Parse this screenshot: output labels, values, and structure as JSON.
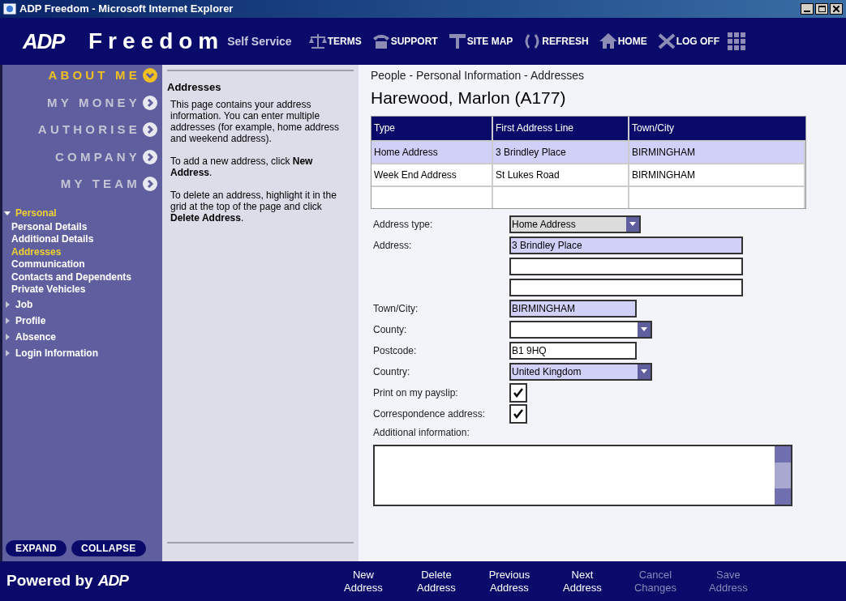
{
  "window": {
    "title": "ADP Freedom - Microsoft Internet Explorer"
  },
  "header": {
    "logo": "ADP",
    "app_name": "Freedom",
    "subtitle": "Self Service",
    "toolbar": [
      {
        "label": "TERMS",
        "kind": "terms"
      },
      {
        "label": "SUPPORT",
        "kind": "support"
      },
      {
        "label": "SITE MAP",
        "kind": "sitemap"
      },
      {
        "label": "REFRESH",
        "kind": "refresh"
      },
      {
        "label": "HOME",
        "kind": "home"
      },
      {
        "label": "LOG OFF",
        "kind": "logoff"
      }
    ]
  },
  "nav": {
    "sections": [
      {
        "label": "ABOUT ME",
        "selected": true
      },
      {
        "label": "MY MONEY",
        "selected": false
      },
      {
        "label": "AUTHORISE",
        "selected": false
      },
      {
        "label": "COMPANY",
        "selected": false
      },
      {
        "label": "MY TEAM",
        "selected": false
      }
    ],
    "tree": [
      {
        "label": "Personal",
        "expanded": true,
        "children": [
          {
            "label": "Personal Details",
            "selected": false
          },
          {
            "label": "Additional Details",
            "selected": false
          },
          {
            "label": "Addresses",
            "selected": true
          },
          {
            "label": "Communication",
            "selected": false
          },
          {
            "label": "Contacts and Dependents",
            "selected": false
          },
          {
            "label": "Private Vehicles",
            "selected": false
          }
        ]
      },
      {
        "label": "Job",
        "expanded": false
      },
      {
        "label": "Profile",
        "expanded": false
      },
      {
        "label": "Absence",
        "expanded": false
      },
      {
        "label": "Login Information",
        "expanded": false
      }
    ],
    "buttons": [
      "EXPAND",
      "COLLAPSE"
    ]
  },
  "help": {
    "title": "Addresses",
    "paragraphs": [
      "This page contains your address information. You can enter multiple addresses (for example, home address and weekend address).",
      "To add a new address, click **New Address**.",
      "To delete an address, highlight it in the grid at the top of the page and click **Delete Address**."
    ]
  },
  "breadcrumb": "People - Personal Information - Addresses",
  "person": "Harewood, Marlon (A177)",
  "table": {
    "columns": [
      "Type",
      "First Address Line",
      "Town/City"
    ],
    "rows": [
      {
        "cells": [
          "Home Address",
          "3 Brindley Place",
          "BIRMINGHAM"
        ],
        "selected": true
      },
      {
        "cells": [
          "Week End Address",
          "St Lukes Road",
          "BIRMINGHAM"
        ],
        "selected": false
      }
    ]
  },
  "form": [
    {
      "kind": "select",
      "label": "Address type:",
      "value": "Home Address",
      "required": false
    },
    {
      "kind": "input",
      "label": "Address:",
      "value": "3 Brindley Place",
      "required": true
    },
    {
      "kind": "input",
      "required": false
    },
    {
      "kind": "input",
      "required": false
    },
    {
      "kind": "input",
      "label": "Town/City:",
      "value": "BIRMINGHAM",
      "required": true
    },
    {
      "kind": "select",
      "label": "County:",
      "required": false
    },
    {
      "kind": "input",
      "label": "Postcode:",
      "value": "B1 9HQ",
      "required": false
    },
    {
      "kind": "select",
      "label": "Country:",
      "value": "United Kingdom",
      "required": true
    },
    {
      "kind": "checkbox",
      "label": "Print on my payslip:",
      "checked": true
    },
    {
      "kind": "checkbox",
      "label": "Correspondence address:",
      "checked": true
    },
    {
      "kind": "textarea",
      "label": "Additional information:"
    }
  ],
  "footer": {
    "powered_by": "Powered by",
    "logo": "ADP",
    "actions": [
      {
        "label": "New Address",
        "disabled": false
      },
      {
        "label": "Delete Address",
        "disabled": false
      },
      {
        "label": "Previous Address",
        "disabled": false
      },
      {
        "label": "Next Address",
        "disabled": false
      },
      {
        "label": "Cancel Changes",
        "disabled": true
      },
      {
        "label": "Save Address",
        "disabled": true
      }
    ]
  }
}
